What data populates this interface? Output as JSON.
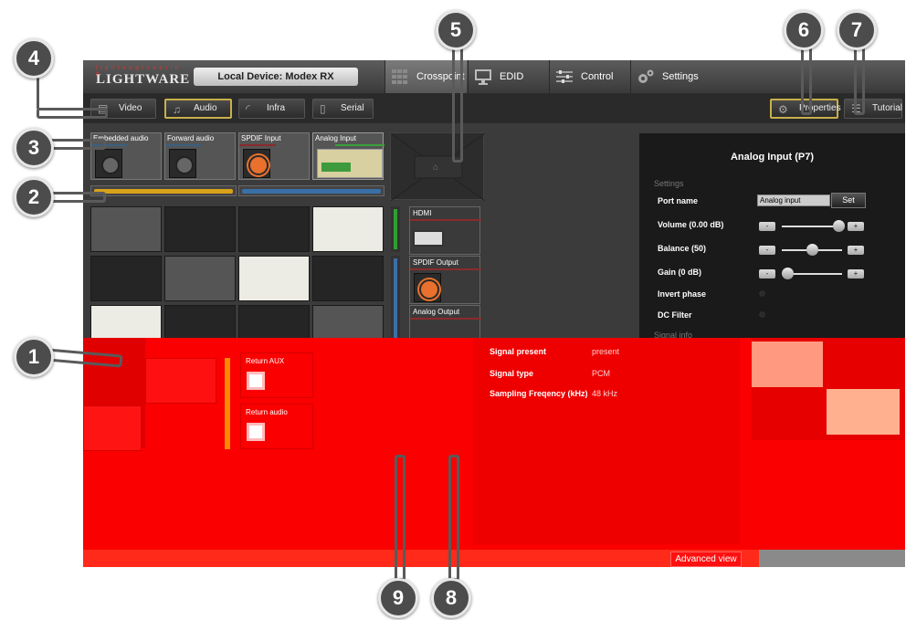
{
  "header": {
    "logo_small": "l i g h t  e n g i n e e r i n g",
    "logo_text": "LIGHTWARE",
    "device_title": "Local Device: Modex RX",
    "tabs": [
      {
        "label": "Crosspoint",
        "icon": "crosspoint-icon"
      },
      {
        "label": "EDID",
        "icon": "monitor-icon"
      },
      {
        "label": "Control",
        "icon": "sliders-icon"
      },
      {
        "label": "Settings",
        "icon": "gears-icon"
      }
    ]
  },
  "toolbar": {
    "buttons": [
      {
        "label": "Video",
        "icon": "film-icon"
      },
      {
        "label": "Audio",
        "icon": "music-note-icon"
      },
      {
        "label": "Infra",
        "icon": "infrared-icon"
      },
      {
        "label": "Serial",
        "icon": "serial-icon"
      }
    ],
    "properties_label": "Properties",
    "tutorial_label": "Tutorial"
  },
  "sources": [
    {
      "label": "Embedded audio",
      "icon": "xlr-connector-icon"
    },
    {
      "label": "Forward audio",
      "icon": "xlr-connector-icon"
    },
    {
      "label": "SPDIF Input",
      "icon": "rca-connector-icon"
    },
    {
      "label": "Analog Input",
      "icon": "phoenix-connector-icon"
    }
  ],
  "destinations": [
    {
      "label": "HDMI",
      "icon": "hdmi-connector-icon"
    },
    {
      "label": "SPDIF Output",
      "icon": "rca-connector-icon"
    },
    {
      "label": "Analog Output",
      "icon": "phoenix-connector-icon"
    },
    {
      "label": "Return AUX",
      "icon": "xlr-connector-icon"
    },
    {
      "label": "Return audio",
      "icon": "xlr-connector-icon"
    }
  ],
  "panel": {
    "title": "Analog Input (P7)",
    "settings_label": "Settings",
    "port_name_label": "Port name",
    "port_name_value": "Analog input",
    "set_label": "Set",
    "volume_label": "Volume (0.00 dB)",
    "volume_level": 0.95,
    "balance_label": "Balance (50)",
    "balance_level": 0.5,
    "gain_label": "Gain (0 dB)",
    "gain_level": 0.0,
    "minus": "-",
    "plus": "+",
    "invert_label": "Invert phase",
    "dc_label": "DC Filter",
    "signal_info_label": "Signal info",
    "signal_present_label": "Signal present",
    "signal_present_value": "present",
    "signal_type_label": "Signal type",
    "signal_type_value": "PCM",
    "sampling_label": "Sampling Freqency (kHz)",
    "sampling_value": "48 kHz"
  },
  "footer": {
    "advanced_view": "Advanced view"
  },
  "callouts": [
    "1",
    "2",
    "3",
    "4",
    "5",
    "6",
    "7",
    "8",
    "9"
  ],
  "colors": {
    "overlay_red": "#fa0000",
    "audio_bar": "#d8a21a",
    "output_bar": "#3a6fa8",
    "highlight_border": "#c8b04a"
  }
}
